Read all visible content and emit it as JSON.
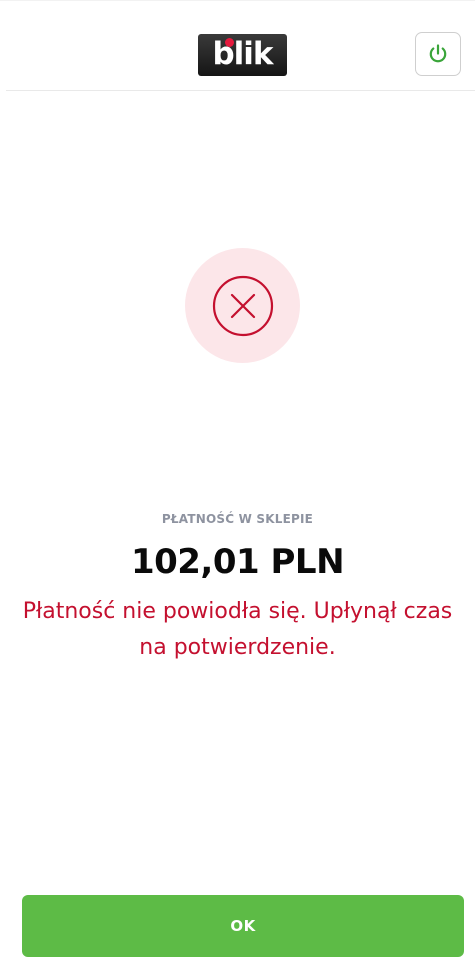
{
  "header": {
    "logo_text": "blik",
    "logo_accent_color": "#e5193d",
    "power_button_icon": "power-icon",
    "power_icon_color": "#3aa53a"
  },
  "status": {
    "icon": "error-x-circle-icon",
    "icon_color": "#c4102f",
    "background_color": "#fce6e9"
  },
  "transaction": {
    "type_label": "PŁATNOŚĆ W SKLEPIE",
    "amount": "102,01 PLN",
    "message": "Płatność nie powiodła się. Upłynął czas na potwierdzenie."
  },
  "actions": {
    "ok_label": "OK",
    "ok_color": "#5dbb46"
  }
}
